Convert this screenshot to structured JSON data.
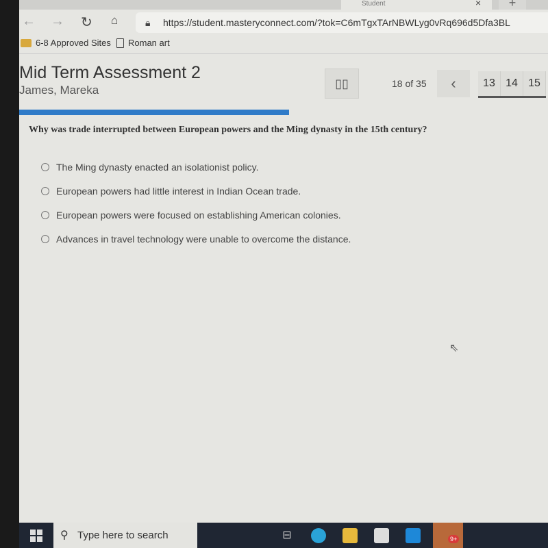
{
  "browser": {
    "tab_title": "Student",
    "url": "https://student.masteryconnect.com/?tok=C6mTgxTArNBWLyg0vRq696d5Dfa3BL",
    "bookmarks": [
      {
        "label": "6-8 Approved Sites",
        "icon": "folder-icon"
      },
      {
        "label": "Roman art",
        "icon": "page-icon"
      }
    ]
  },
  "assessment": {
    "title": "Mid Term Assessment 2",
    "student": "James, Mareka",
    "counter": "18 of 35",
    "question_numbers": [
      "13",
      "14",
      "15"
    ],
    "progress_percent": 51,
    "accent": "#2f7bc8"
  },
  "question": {
    "text": "Why was trade interrupted between European powers and the Ming dynasty in the 15th century?",
    "options": [
      "The Ming dynasty enacted an isolationist policy.",
      "European powers had little interest in Indian Ocean trade.",
      "European powers were focused on establishing American colonies.",
      "Advances in travel technology were unable to overcome the distance."
    ]
  },
  "taskbar": {
    "search_placeholder": "Type here to search",
    "teams_badge": "9+"
  }
}
